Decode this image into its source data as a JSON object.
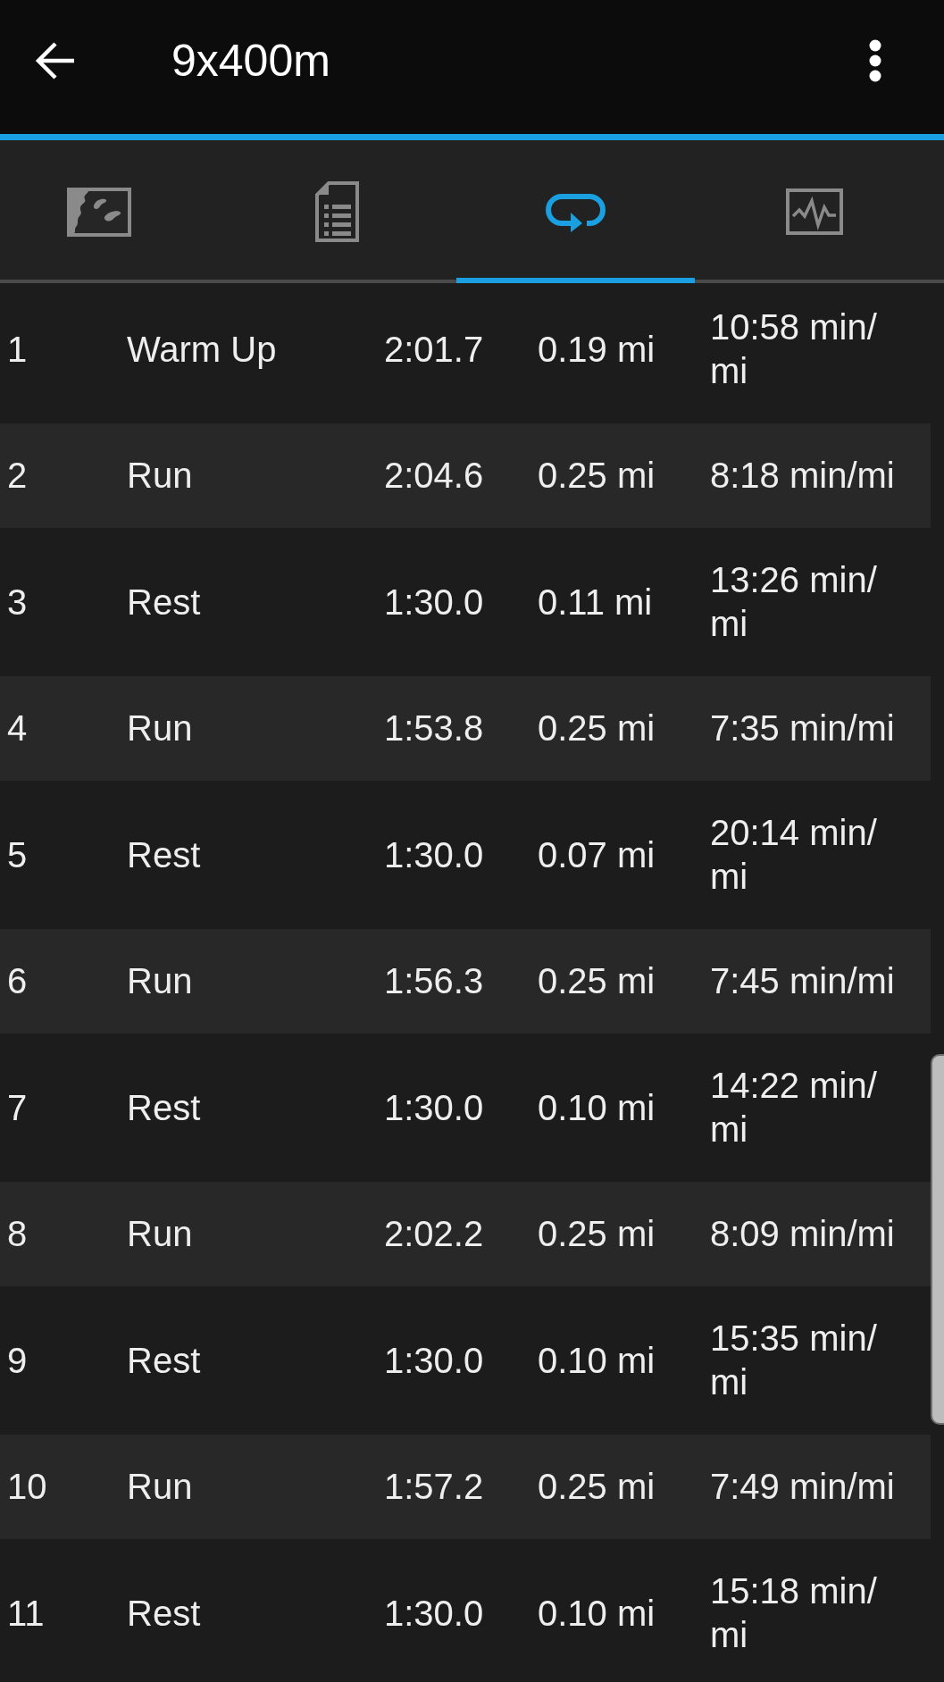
{
  "app_bar": {
    "title": "9x400m"
  },
  "tabs": [
    {
      "kind": "map",
      "selected": false
    },
    {
      "kind": "details",
      "selected": false
    },
    {
      "kind": "laps",
      "selected": true
    },
    {
      "kind": "charts",
      "selected": false
    }
  ],
  "laps": [
    {
      "number": "1",
      "step": "Warm Up",
      "time": "2:01.7",
      "distance": "0.19 mi",
      "pace": "10:58 min/mi"
    },
    {
      "number": "2",
      "step": "Run",
      "time": "2:04.6",
      "distance": "0.25 mi",
      "pace": "8:18 min/mi"
    },
    {
      "number": "3",
      "step": "Rest",
      "time": "1:30.0",
      "distance": "0.11 mi",
      "pace": "13:26 min/mi"
    },
    {
      "number": "4",
      "step": "Run",
      "time": "1:53.8",
      "distance": "0.25 mi",
      "pace": "7:35 min/mi"
    },
    {
      "number": "5",
      "step": "Rest",
      "time": "1:30.0",
      "distance": "0.07 mi",
      "pace": "20:14 min/mi"
    },
    {
      "number": "6",
      "step": "Run",
      "time": "1:56.3",
      "distance": "0.25 mi",
      "pace": "7:45 min/mi"
    },
    {
      "number": "7",
      "step": "Rest",
      "time": "1:30.0",
      "distance": "0.10 mi",
      "pace": "14:22 min/mi"
    },
    {
      "number": "8",
      "step": "Run",
      "time": "2:02.2",
      "distance": "0.25 mi",
      "pace": "8:09 min/mi"
    },
    {
      "number": "9",
      "step": "Rest",
      "time": "1:30.0",
      "distance": "0.10 mi",
      "pace": "15:35 min/mi"
    },
    {
      "number": "10",
      "step": "Run",
      "time": "1:57.2",
      "distance": "0.25 mi",
      "pace": "7:49 min/mi"
    },
    {
      "number": "11",
      "step": "Rest",
      "time": "1:30.0",
      "distance": "0.10 mi",
      "pace": "15:18 min/mi"
    }
  ]
}
